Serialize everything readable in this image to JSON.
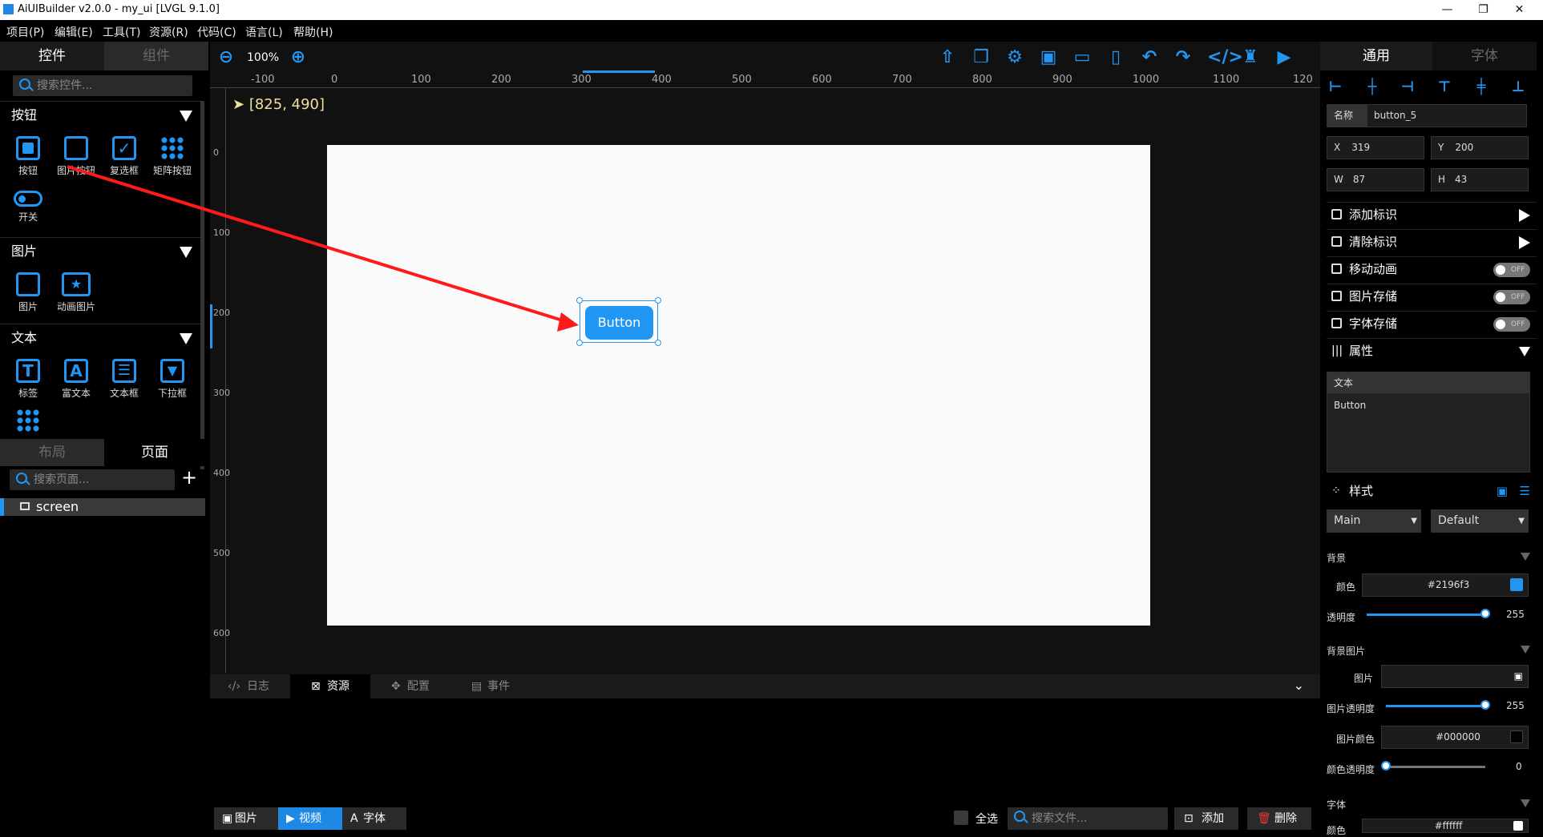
{
  "window": {
    "title": "AiUIBuilder v2.0.0 - my_ui [LVGL 9.1.0]"
  },
  "menu": [
    "项目(P)",
    "编辑(E)",
    "工具(T)",
    "资源(R)",
    "代码(C)",
    "语言(L)",
    "帮助(H)"
  ],
  "left": {
    "tabs": {
      "controls": "控件",
      "components": "组件"
    },
    "search_placeholder": "搜索控件...",
    "sections": {
      "buttons": {
        "title": "按钮",
        "items": [
          "按钮",
          "图片按钮",
          "复选框",
          "矩阵按钮",
          "开关"
        ]
      },
      "images": {
        "title": "图片",
        "items": [
          "图片",
          "动画图片"
        ]
      },
      "text": {
        "title": "文本",
        "items": [
          "标签",
          "富文本",
          "文本框",
          "下拉框"
        ]
      }
    },
    "page_tabs": {
      "layout": "布局",
      "page": "页面"
    },
    "page_search_placeholder": "搜索页面...",
    "add_label": "+",
    "pages": [
      "screen"
    ]
  },
  "toolbar": {
    "zoom": "100%"
  },
  "canvas": {
    "coords": "[825, 490]",
    "h_ticks": [
      "-100",
      "0",
      "100",
      "200",
      "300",
      "400",
      "500",
      "600",
      "700",
      "800",
      "900",
      "1000",
      "1100",
      "120"
    ],
    "v_ticks": [
      "0",
      "100",
      "200",
      "300",
      "400",
      "500",
      "600"
    ],
    "button_text": "Button"
  },
  "bottom": {
    "tabs": [
      "日志",
      "资源",
      "配置",
      "事件"
    ],
    "asset_tabs": [
      "图片",
      "视频",
      "字体"
    ],
    "select_all": "全选",
    "file_search_placeholder": "搜索文件...",
    "add": "添加",
    "delete": "删除"
  },
  "right": {
    "tabs": {
      "general": "通用",
      "font": "字体"
    },
    "name_label": "名称",
    "name_value": "button_5",
    "x_label": "X",
    "x_value": "319",
    "y_label": "Y",
    "y_value": "200",
    "w_label": "W",
    "w_value": "87",
    "h_label": "H",
    "h_value": "43",
    "rows": [
      "添加标识",
      "清除标识",
      "移动动画",
      "图片存储",
      "字体存储",
      "属性"
    ],
    "switch_off": "OFF",
    "text_label": "文本",
    "text_value": "Button",
    "style_title": "样式",
    "part": "Main",
    "state": "Default",
    "bg_title": "背景",
    "color_label": "颜色",
    "color_value": "#2196f3",
    "opacity_label": "透明度",
    "opacity_value": "255",
    "bgimg_title": "背景图片",
    "img_label": "图片",
    "img_opacity_label": "图片透明度",
    "img_opacity_value": "255",
    "img_color_label": "图片颜色",
    "img_color_value": "#000000",
    "color_opacity_label": "颜色透明度",
    "color_opacity_value": "0",
    "font_title": "字体",
    "font_color_label": "颜色",
    "font_color_value": "#ffffff"
  }
}
